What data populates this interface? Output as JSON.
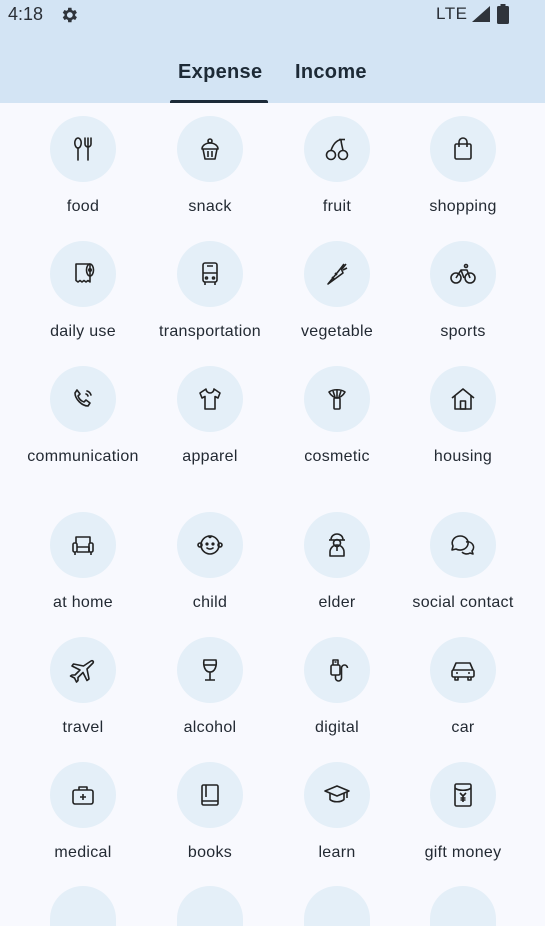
{
  "status": {
    "time": "4:18",
    "network": "LTE"
  },
  "tabs": [
    {
      "label": "Expense",
      "selected": true
    },
    {
      "label": "Income",
      "selected": false
    }
  ],
  "categories": [
    {
      "label": "food",
      "icon": "food-icon"
    },
    {
      "label": "snack",
      "icon": "cupcake-icon"
    },
    {
      "label": "fruit",
      "icon": "cherry-icon"
    },
    {
      "label": "shopping",
      "icon": "shopping-bag-icon"
    },
    {
      "label": "daily use",
      "icon": "toilet-paper-icon"
    },
    {
      "label": "transportation",
      "icon": "bus-icon"
    },
    {
      "label": "vegetable",
      "icon": "carrot-icon"
    },
    {
      "label": "sports",
      "icon": "bicycle-icon"
    },
    {
      "label": "communication",
      "icon": "phone-icon"
    },
    {
      "label": "apparel",
      "icon": "tshirt-icon"
    },
    {
      "label": "cosmetic",
      "icon": "lipstick-icon"
    },
    {
      "label": "housing",
      "icon": "house-icon"
    },
    {
      "label": "at home",
      "icon": "armchair-icon"
    },
    {
      "label": "child",
      "icon": "baby-icon"
    },
    {
      "label": "elder",
      "icon": "elder-icon"
    },
    {
      "label": "social contact",
      "icon": "chat-bubbles-icon"
    },
    {
      "label": "travel",
      "icon": "airplane-icon"
    },
    {
      "label": "alcohol",
      "icon": "wine-glass-icon"
    },
    {
      "label": "digital",
      "icon": "usb-icon"
    },
    {
      "label": "car",
      "icon": "car-icon"
    },
    {
      "label": "medical",
      "icon": "medical-kit-icon"
    },
    {
      "label": "books",
      "icon": "book-icon"
    },
    {
      "label": "learn",
      "icon": "graduation-cap-icon"
    },
    {
      "label": "gift money",
      "icon": "red-envelope-icon"
    }
  ],
  "colors": {
    "header": "#d3e4f4",
    "icon_bg": "#e4eff8",
    "background": "#f8f9fe",
    "indicator": "#1c2a38"
  }
}
